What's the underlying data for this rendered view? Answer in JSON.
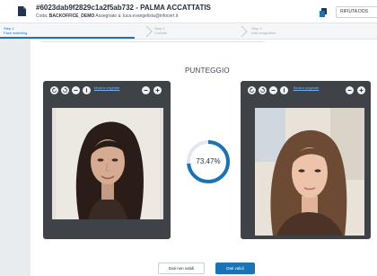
{
  "header": {
    "title": "#6023dab9f2829c1a2f5ab732 - PALMA ACCATTATIS",
    "coda_label": "Coda:",
    "coda_value": "BACKOFFICE_DEMO",
    "assignee_label": "Assegnato a:",
    "assignee_value": "luca.evangelista@infocert.it",
    "refuse_button": "RIFIUTA DOS"
  },
  "stepper": {
    "steps": [
      {
        "num": "Step 1",
        "label": "Face matching",
        "state": "active"
      },
      {
        "num": "Step 2",
        "label": "Contatti",
        "state": "inactive"
      },
      {
        "num": "Step 3",
        "label": "Dati anagrafica",
        "state": "inactive"
      }
    ]
  },
  "main": {
    "heading": "PUNTEGGIO",
    "left_viewer": {
      "original_link": "Mostra originale"
    },
    "right_viewer": {
      "original_link": "Mostra originale"
    },
    "score": {
      "text": "73.47%",
      "value": 73.47
    },
    "buttons": {
      "mismatch": "Dati non validi",
      "match": "Dati validi"
    }
  },
  "colors": {
    "accent": "#1a73b5",
    "viewer_bg": "#3f4347",
    "link": "#6fb5ff"
  }
}
